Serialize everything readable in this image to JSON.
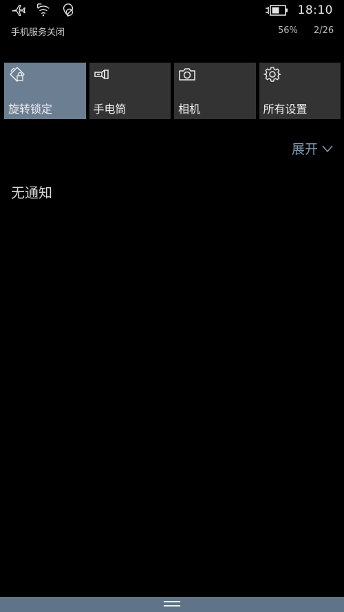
{
  "status_bar": {
    "icons": [
      "airplane-icon",
      "wifi-off-icon",
      "location-off-icon"
    ],
    "battery_icon": "battery-charging-icon",
    "time": "18:10",
    "service_status": "手机服务关闭",
    "battery_percent": "56%",
    "date": "2/26"
  },
  "quick_actions": [
    {
      "label": "旋转锁定",
      "icon": "rotation-lock-icon",
      "active": true
    },
    {
      "label": "手电筒",
      "icon": "flashlight-icon",
      "active": false
    },
    {
      "label": "相机",
      "icon": "camera-icon",
      "active": false
    },
    {
      "label": "所有设置",
      "icon": "gear-icon",
      "active": false
    }
  ],
  "expand": {
    "label": "展开",
    "icon": "chevron-down-icon"
  },
  "notifications": {
    "empty_text": "无通知"
  },
  "colors": {
    "background": "#000000",
    "tile": "#333333",
    "tile_active": "#6b7e92",
    "accent": "#7f97ae",
    "bottom_bar": "#5f7488"
  }
}
